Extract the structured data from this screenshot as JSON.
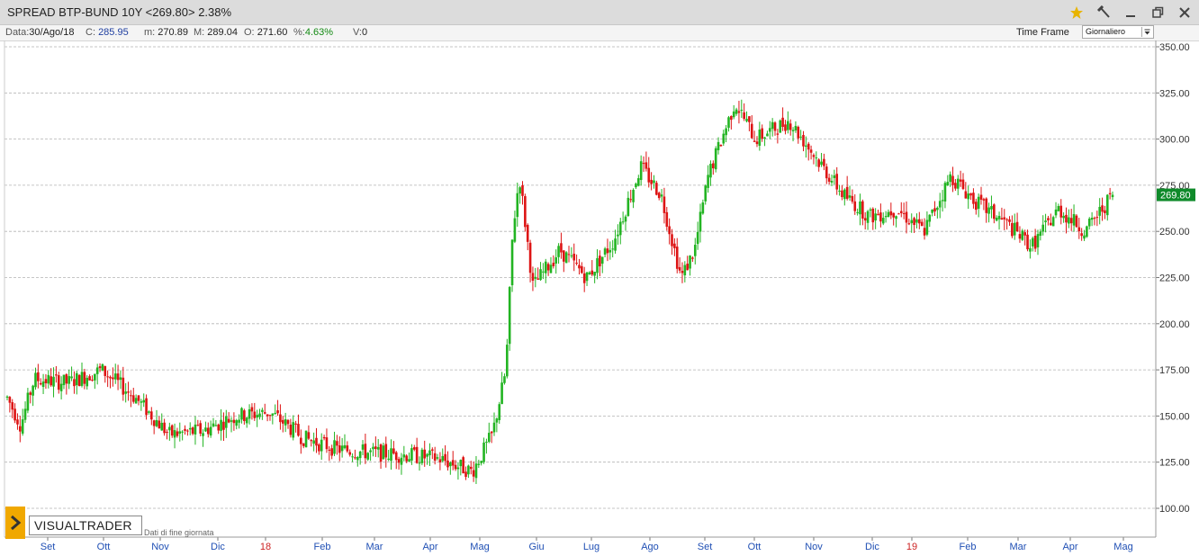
{
  "window": {
    "title": "SPREAD BTP-BUND 10Y <269.80> 2.38%"
  },
  "infobar": {
    "date_label": "Data:",
    "date_value": "30/Ago/18",
    "close_label": "C:",
    "close_value": "285.95",
    "min_label": "m:",
    "min_value": "270.89",
    "max_label": "M:",
    "max_value": "289.04",
    "open_label": "O:",
    "open_value": "271.60",
    "pct_label": "%:",
    "pct_value": "4.63%",
    "vol_label": "V:",
    "vol_value": "0",
    "timeframe_label": "Time Frame",
    "timeframe_value": "Giornaliero"
  },
  "branding": {
    "logo_text": "VISUALTRADER",
    "subtitle": "Dati di fine giornata"
  },
  "colors": {
    "up": "#22b422",
    "down": "#dd1414",
    "grid": "#b4b4b4",
    "last_price_bg": "#0f8a2a",
    "year_label": "#cc2222",
    "month_label": "#1f4fb4"
  },
  "icons": [
    "star-icon",
    "hammer-icon",
    "minimize-icon",
    "maximize-icon",
    "close-icon",
    "chevron-right-icon"
  ],
  "chart_data": {
    "type": "candlestick",
    "ylim": [
      100,
      350
    ],
    "y_ticks": [
      "350.00",
      "325.00",
      "300.00",
      "275.00",
      "250.00",
      "225.00",
      "200.00",
      "175.00",
      "150.00",
      "125.00",
      "100.00"
    ],
    "last_price": "269.80",
    "last_value": 269.8,
    "x_labels": [
      {
        "text": "Set",
        "type": "month"
      },
      {
        "text": "Ott",
        "type": "month"
      },
      {
        "text": "Nov",
        "type": "month"
      },
      {
        "text": "Dic",
        "type": "month"
      },
      {
        "text": "18",
        "type": "year"
      },
      {
        "text": "Feb",
        "type": "month"
      },
      {
        "text": "Mar",
        "type": "month"
      },
      {
        "text": "Apr",
        "type": "month"
      },
      {
        "text": "Mag",
        "type": "month"
      },
      {
        "text": "Giu",
        "type": "month"
      },
      {
        "text": "Lug",
        "type": "month"
      },
      {
        "text": "Ago",
        "type": "month"
      },
      {
        "text": "Set",
        "type": "month"
      },
      {
        "text": "Ott",
        "type": "month"
      },
      {
        "text": "Nov",
        "type": "month"
      },
      {
        "text": "Dic",
        "type": "month"
      },
      {
        "text": "19",
        "type": "year"
      },
      {
        "text": "Feb",
        "type": "month"
      },
      {
        "text": "Mar",
        "type": "month"
      },
      {
        "text": "Apr",
        "type": "month"
      },
      {
        "text": "Mag",
        "type": "month"
      }
    ],
    "trend": [
      [
        2017.66,
        160
      ],
      [
        2017.68,
        145
      ],
      [
        2017.7,
        170
      ],
      [
        2017.75,
        168
      ],
      [
        2017.8,
        175
      ],
      [
        2017.85,
        160
      ],
      [
        2017.9,
        140
      ],
      [
        2017.95,
        142
      ],
      [
        2018.0,
        150
      ],
      [
        2018.05,
        152
      ],
      [
        2018.1,
        138
      ],
      [
        2018.15,
        132
      ],
      [
        2018.2,
        130
      ],
      [
        2018.25,
        129
      ],
      [
        2018.3,
        127
      ],
      [
        2018.35,
        120
      ],
      [
        2018.38,
        140
      ],
      [
        2018.4,
        175
      ],
      [
        2018.41,
        250
      ],
      [
        2018.42,
        280
      ],
      [
        2018.44,
        220
      ],
      [
        2018.48,
        240
      ],
      [
        2018.52,
        225
      ],
      [
        2018.56,
        245
      ],
      [
        2018.6,
        285
      ],
      [
        2018.63,
        270
      ],
      [
        2018.66,
        225
      ],
      [
        2018.68,
        240
      ],
      [
        2018.7,
        280
      ],
      [
        2018.74,
        320
      ],
      [
        2018.77,
        300
      ],
      [
        2018.82,
        310
      ],
      [
        2018.86,
        290
      ],
      [
        2018.9,
        270
      ],
      [
        2018.94,
        258
      ],
      [
        2018.98,
        262
      ],
      [
        2019.02,
        250
      ],
      [
        2019.06,
        280
      ],
      [
        2019.1,
        265
      ],
      [
        2019.14,
        255
      ],
      [
        2019.18,
        242
      ],
      [
        2019.22,
        262
      ],
      [
        2019.26,
        250
      ],
      [
        2019.3,
        269.8
      ]
    ]
  }
}
